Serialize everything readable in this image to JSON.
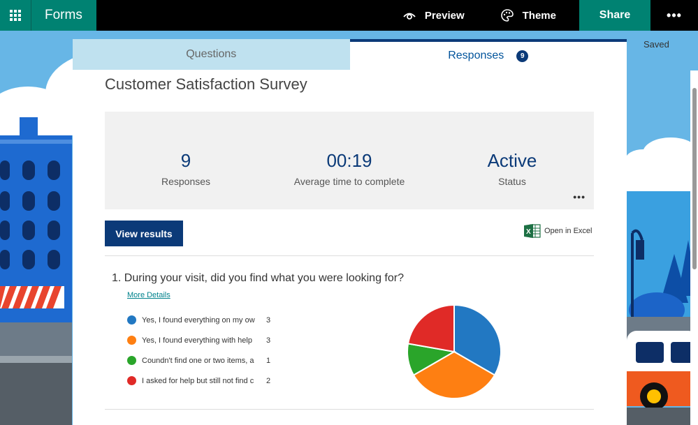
{
  "app": {
    "name": "Forms"
  },
  "toolbar": {
    "preview_label": "Preview",
    "theme_label": "Theme",
    "share_label": "Share",
    "more_label": "•••"
  },
  "status": {
    "saved": "Saved"
  },
  "tabs": {
    "questions_label": "Questions",
    "responses_label": "Responses",
    "responses_count": "9"
  },
  "survey": {
    "title": "Customer Satisfaction Survey"
  },
  "summary": {
    "responses_value": "9",
    "responses_label": "Responses",
    "avg_time_value": "00:19",
    "avg_time_label": "Average time to complete",
    "status_value": "Active",
    "status_label": "Status",
    "more_label": "•••"
  },
  "actions": {
    "view_results_label": "View results",
    "open_excel_label": "Open in Excel"
  },
  "question1": {
    "title": "1.  During your visit, did you find what you were looking for?",
    "more_details_label": "More Details",
    "options": [
      {
        "label": "Yes, I found everything on my ow",
        "count": "3",
        "color": "#2278c2"
      },
      {
        "label": "Yes, I found everything with help",
        "count": "3",
        "color": "#fe7f12"
      },
      {
        "label": "Coundn't find one or two items, a",
        "count": "1",
        "color": "#2aa52a"
      },
      {
        "label": "I asked for help but still not find c",
        "count": "2",
        "color": "#e02a27"
      }
    ]
  },
  "chart_data": {
    "type": "pie",
    "categories": [
      "Yes, I found everything on my ow",
      "Yes, I found everything with help",
      "Coundn't find one or two items, a",
      "I asked for help but still not find c"
    ],
    "values": [
      3,
      3,
      1,
      2
    ],
    "colors": [
      "#2278c2",
      "#fe7f12",
      "#2aa52a",
      "#e02a27"
    ]
  },
  "colors": {
    "brand": "#008272",
    "accent": "#0b3a78",
    "sky": "#67b6e6"
  }
}
